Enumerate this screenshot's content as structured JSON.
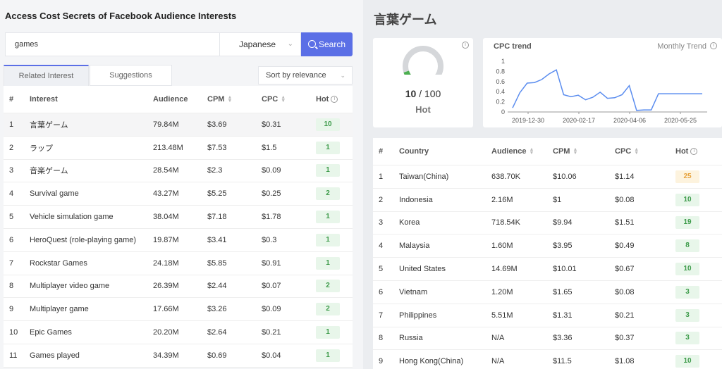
{
  "left": {
    "title": "Access Cost Secrets of Facebook Audience Interests",
    "search": {
      "value": "games"
    },
    "language": {
      "selected": "Japanese"
    },
    "search_button": "Search",
    "tabs": [
      "Related Interest",
      "Suggestions"
    ],
    "sort": {
      "selected": "Sort by relevance"
    },
    "table": {
      "headers": [
        "#",
        "Interest",
        "Audience",
        "CPM",
        "CPC",
        "Hot"
      ],
      "rows": [
        {
          "idx": "1",
          "name": "言葉ゲーム",
          "audience": "79.84M",
          "cpm": "$3.69",
          "cpc": "$0.31",
          "hot": "10"
        },
        {
          "idx": "2",
          "name": "ラップ",
          "audience": "213.48M",
          "cpm": "$7.53",
          "cpc": "$1.5",
          "hot": "1"
        },
        {
          "idx": "3",
          "name": "音楽ゲーム",
          "audience": "28.54M",
          "cpm": "$2.3",
          "cpc": "$0.09",
          "hot": "1"
        },
        {
          "idx": "4",
          "name": "Survival game",
          "audience": "43.27M",
          "cpm": "$5.25",
          "cpc": "$0.25",
          "hot": "2"
        },
        {
          "idx": "5",
          "name": "Vehicle simulation game",
          "audience": "38.04M",
          "cpm": "$7.18",
          "cpc": "$1.78",
          "hot": "1"
        },
        {
          "idx": "6",
          "name": "HeroQuest (role-playing game)",
          "audience": "19.87M",
          "cpm": "$3.41",
          "cpc": "$0.3",
          "hot": "1"
        },
        {
          "idx": "7",
          "name": "Rockstar Games",
          "audience": "24.18M",
          "cpm": "$5.85",
          "cpc": "$0.91",
          "hot": "1"
        },
        {
          "idx": "8",
          "name": "Multiplayer video game",
          "audience": "26.39M",
          "cpm": "$2.44",
          "cpc": "$0.07",
          "hot": "2"
        },
        {
          "idx": "9",
          "name": "Multiplayer game",
          "audience": "17.66M",
          "cpm": "$3.26",
          "cpc": "$0.09",
          "hot": "2"
        },
        {
          "idx": "10",
          "name": "Epic Games",
          "audience": "20.20M",
          "cpm": "$2.64",
          "cpc": "$0.21",
          "hot": "1"
        },
        {
          "idx": "11",
          "name": "Games played",
          "audience": "34.39M",
          "cpm": "$0.69",
          "cpc": "$0.04",
          "hot": "1"
        }
      ]
    }
  },
  "right": {
    "title": "言葉ゲーム",
    "gauge": {
      "value": "10",
      "max": "/ 100",
      "label": "Hot",
      "fraction": 0.1
    },
    "trend": {
      "title": "CPC trend",
      "link": "Monthly Trend"
    },
    "table": {
      "headers": [
        "#",
        "Country",
        "Audience",
        "CPM",
        "CPC",
        "Hot"
      ],
      "rows": [
        {
          "idx": "1",
          "name": "Taiwan(China)",
          "audience": "638.70K",
          "cpm": "$10.06",
          "cpc": "$1.14",
          "hot": "25",
          "tone": "orange"
        },
        {
          "idx": "2",
          "name": "Indonesia",
          "audience": "2.16M",
          "cpm": "$1",
          "cpc": "$0.08",
          "hot": "10",
          "tone": "green"
        },
        {
          "idx": "3",
          "name": "Korea",
          "audience": "718.54K",
          "cpm": "$9.94",
          "cpc": "$1.51",
          "hot": "19",
          "tone": "green"
        },
        {
          "idx": "4",
          "name": "Malaysia",
          "audience": "1.60M",
          "cpm": "$3.95",
          "cpc": "$0.49",
          "hot": "8",
          "tone": "green"
        },
        {
          "idx": "5",
          "name": "United States",
          "audience": "14.69M",
          "cpm": "$10.01",
          "cpc": "$0.67",
          "hot": "10",
          "tone": "green"
        },
        {
          "idx": "6",
          "name": "Vietnam",
          "audience": "1.20M",
          "cpm": "$1.65",
          "cpc": "$0.08",
          "hot": "3",
          "tone": "green"
        },
        {
          "idx": "7",
          "name": "Philippines",
          "audience": "5.51M",
          "cpm": "$1.31",
          "cpc": "$0.21",
          "hot": "3",
          "tone": "green"
        },
        {
          "idx": "8",
          "name": "Russia",
          "audience": "N/A",
          "cpm": "$3.36",
          "cpc": "$0.37",
          "hot": "3",
          "tone": "green"
        },
        {
          "idx": "9",
          "name": "Hong Kong(China)",
          "audience": "N/A",
          "cpm": "$11.5",
          "cpc": "$1.08",
          "hot": "10",
          "tone": "green"
        }
      ]
    }
  },
  "chart_data": {
    "type": "line",
    "title": "CPC trend",
    "xlabel": "",
    "ylabel": "",
    "ylim": [
      0,
      1
    ],
    "y_ticks": [
      "0",
      "0.2",
      "0.4",
      "0.6",
      "0.8",
      "1"
    ],
    "x_ticks": [
      "2019-12-30",
      "2020-02-17",
      "2020-04-06",
      "2020-05-25"
    ],
    "values": [
      0.08,
      0.38,
      0.57,
      0.58,
      0.64,
      0.75,
      0.83,
      0.34,
      0.3,
      0.33,
      0.24,
      0.29,
      0.39,
      0.27,
      0.28,
      0.34,
      0.52,
      0.03,
      0.04,
      0.04,
      0.36,
      0.36,
      0.36,
      0.36,
      0.36,
      0.36,
      0.36
    ],
    "color": "#5b8def",
    "grid": false
  },
  "colors": {
    "accent": "#5b6fe6",
    "hot_green": "#3d9b4a",
    "hot_orange": "#e6a23c",
    "gauge_fill": "#4caf50",
    "gauge_track": "#d5d7da"
  }
}
